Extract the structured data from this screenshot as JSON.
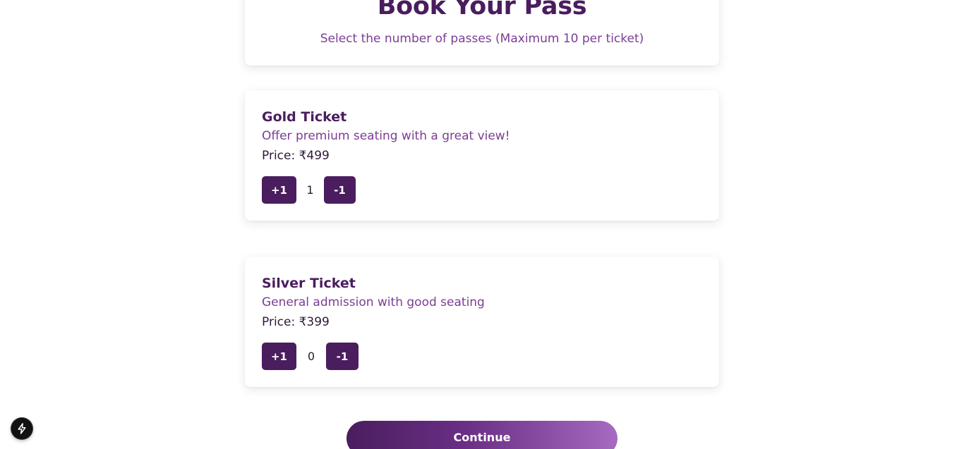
{
  "header": {
    "title": "Book Your Pass",
    "subtitle": "Select the number of passes (Maximum 10 per ticket)"
  },
  "tickets": [
    {
      "name": "Gold Ticket",
      "description": "Offer premium seating with a great view!",
      "price_label": "Price: ",
      "price_value": "₹499",
      "increment_label": "+1",
      "quantity": "1",
      "decrement_label": "-1"
    },
    {
      "name": "Silver Ticket",
      "description": "General admission with good seating",
      "price_label": "Price: ",
      "price_value": "₹399",
      "increment_label": "+1",
      "quantity": "0",
      "decrement_label": "-1"
    }
  ],
  "continue_label": "Continue",
  "dev_badge": {
    "icon": "lightning-icon"
  },
  "colors": {
    "primary": "#4a1d5e",
    "accent_text": "#7b3d95",
    "gradient_end": "#a66bc0"
  }
}
